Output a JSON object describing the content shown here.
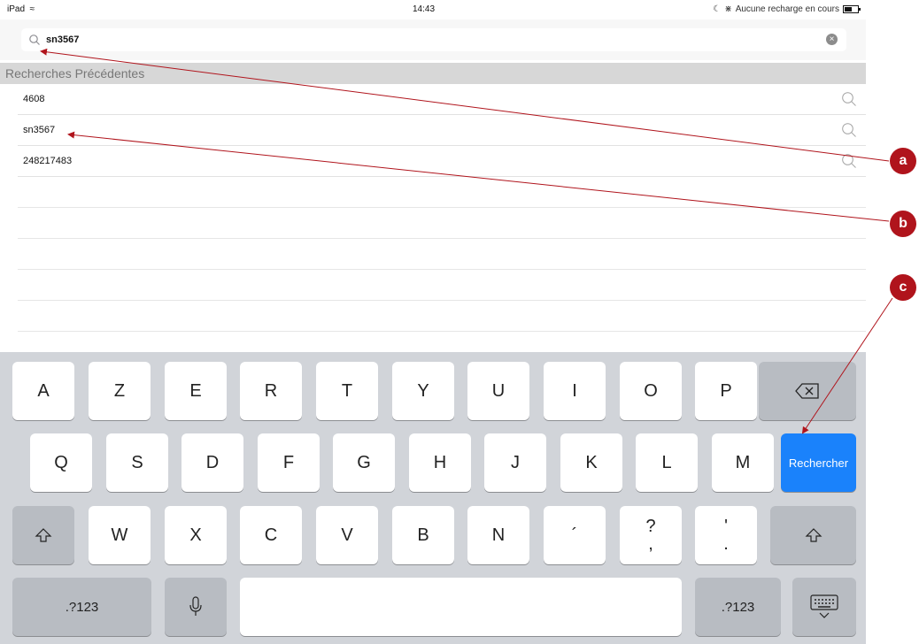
{
  "status_bar": {
    "device": "iPad",
    "time": "14:43",
    "charging": "Aucune recharge en cours"
  },
  "search": {
    "value": "sn3567"
  },
  "recent": {
    "header": "Recherches Précédentes",
    "items": [
      {
        "label": "4608",
        "icon": "search-icon"
      },
      {
        "label": "sn3567",
        "icon": "search-icon"
      },
      {
        "label": "248217483",
        "icon": "search-icon"
      }
    ]
  },
  "keyboard": {
    "row1": [
      "A",
      "Z",
      "E",
      "R",
      "T",
      "Y",
      "U",
      "I",
      "O",
      "P"
    ],
    "row2": [
      "Q",
      "S",
      "D",
      "F",
      "G",
      "H",
      "J",
      "K",
      "L",
      "M"
    ],
    "row3": [
      "W",
      "X",
      "C",
      "V",
      "B",
      "N",
      "´"
    ],
    "question_top": "?",
    "question_bottom": ",",
    "quote_top": "'",
    "quote_bottom": ".",
    "search_key": "Rechercher",
    "numbers_left": ".?123",
    "numbers_right": ".?123"
  },
  "annotations": [
    "a",
    "b",
    "c"
  ],
  "colors": {
    "annotation": "#b0141c",
    "search_key": "#1a82fb",
    "keyboard_bg": "#d1d4d9"
  }
}
